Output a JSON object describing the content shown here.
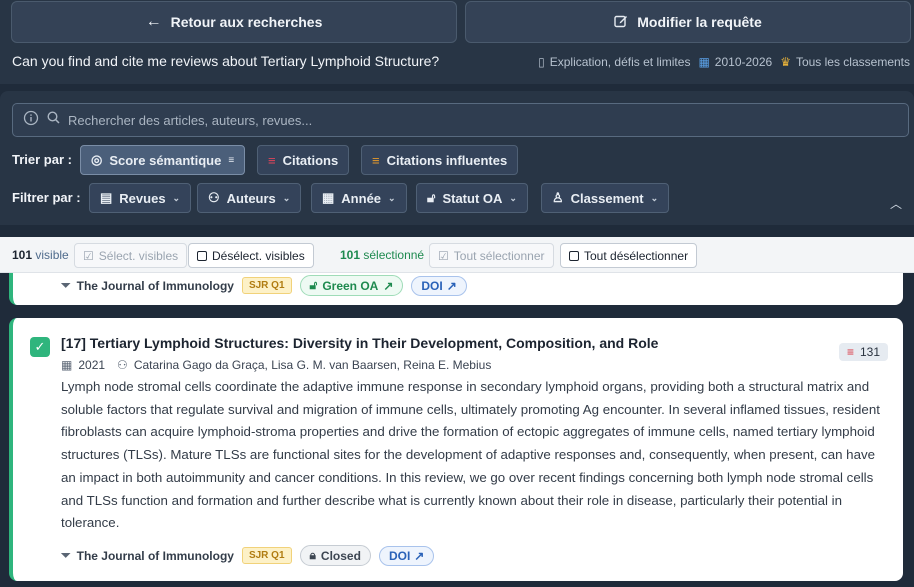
{
  "header": {
    "back_label": "Retour aux recherches",
    "edit_label": "Modifier la requête",
    "query": "Can you find and cite me reviews about Tertiary Lymphoid Structure?",
    "meta_type": "Explication, défis et limites",
    "meta_years": "2010-2026",
    "meta_rank": "Tous les classements"
  },
  "search": {
    "placeholder": "Rechercher des articles, auteurs, revues..."
  },
  "sort": {
    "label": "Trier par :",
    "options": [
      "Score sémantique",
      "Citations",
      "Citations influentes"
    ],
    "active": "Score sémantique"
  },
  "filter": {
    "label": "Filtrer par :",
    "options": [
      "Revues",
      "Auteurs",
      "Année",
      "Statut OA",
      "Classement"
    ]
  },
  "selection": {
    "visible_count": "101",
    "visible_word": "visible",
    "select_visible": "Sélect. visibles",
    "deselect_visible": "Désélect. visibles",
    "selected_count": "101",
    "selected_word": "sélectionné",
    "select_all": "Tout sélectionner",
    "deselect_all": "Tout désélectionner"
  },
  "prev_card": {
    "journal": "The Journal of Immunology",
    "sjr": "SJR Q1",
    "oa": "Green OA",
    "doi": "DOI"
  },
  "card": {
    "title": "[17] Tertiary Lymphoid Structures: Diversity in Their Development, Composition, and Role",
    "year": "2021",
    "authors": "Catarina Gago da Graça, Lisa G. M. van Baarsen, Reina E. Mebius",
    "citations": "131",
    "abstract": "Lymph node stromal cells coordinate the adaptive immune response in secondary lymphoid organs, providing both a structural matrix and soluble factors that regulate survival and migration of immune cells, ultimately promoting Ag encounter. In several inflamed tissues, resident fibroblasts can acquire lymphoid-stroma properties and drive the formation of ectopic aggregates of immune cells, named tertiary lymphoid structures (TLSs). Mature TLSs are functional sites for the development of adaptive responses and, consequently, when present, can have an impact in both autoimmunity and cancer conditions. In this review, we go over recent findings concerning both lymph node stromal cells and TLSs function and formation and further describe what is currently known about their role in disease, particularly their potential in tolerance.",
    "journal": "The Journal of Immunology",
    "sjr": "SJR Q1",
    "oa": "Closed",
    "doi": "DOI"
  }
}
